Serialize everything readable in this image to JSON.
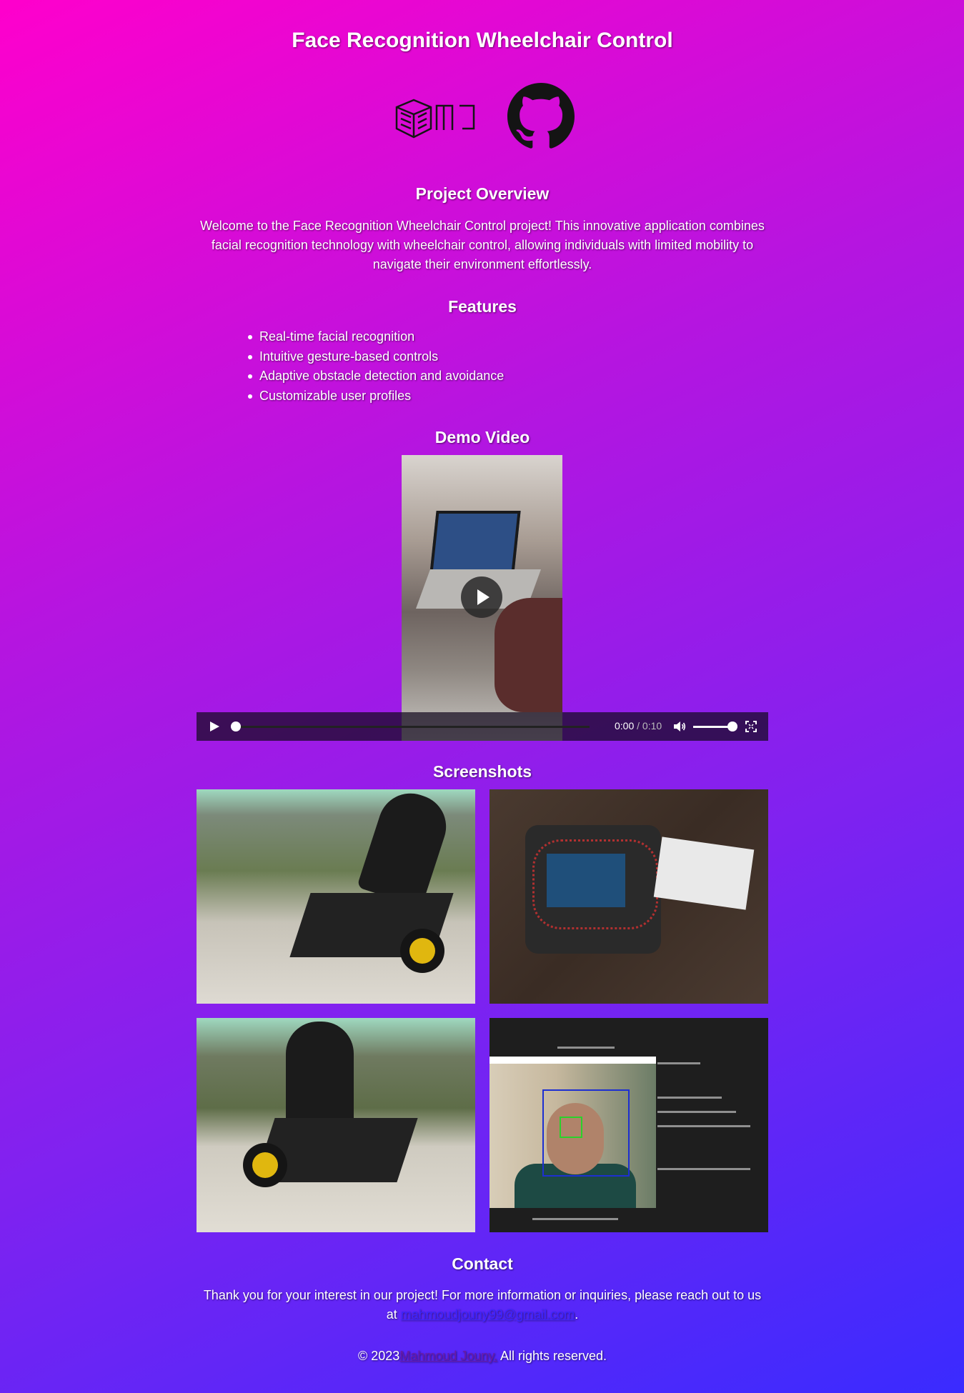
{
  "header": {
    "title": "Face Recognition Wheelchair Control"
  },
  "logos": {
    "mj_text": "MJ"
  },
  "overview": {
    "heading": "Project Overview",
    "text": "Welcome to the Face Recognition Wheelchair Control project! This innovative application combines facial recognition technology with wheelchair control, allowing individuals with limited mobility to navigate their environment effortlessly."
  },
  "features": {
    "heading": "Features",
    "items": [
      "Real-time facial recognition",
      "Intuitive gesture-based controls",
      "Adaptive obstacle detection and avoidance",
      "Customizable user profiles"
    ]
  },
  "demo": {
    "heading": "Demo Video",
    "current_time": "0:00",
    "separator": " / ",
    "duration": "0:10",
    "progress": 0,
    "volume": 1
  },
  "screenshots": {
    "heading": "Screenshots"
  },
  "contact": {
    "heading": "Contact",
    "text_before": "Thank you for your interest in our project! For more information or inquiries, please reach out to us at ",
    "email": "mahmoudjouny99@gmail.com",
    "text_after": "."
  },
  "footer": {
    "copyright": "© 2023",
    "name": "Mahmoud Jouny.",
    "rights": " All rights reserved."
  },
  "colors": {
    "gradient_start": "#ff00cc",
    "gradient_end": "#3a2bff",
    "link": "#3d25ff"
  }
}
